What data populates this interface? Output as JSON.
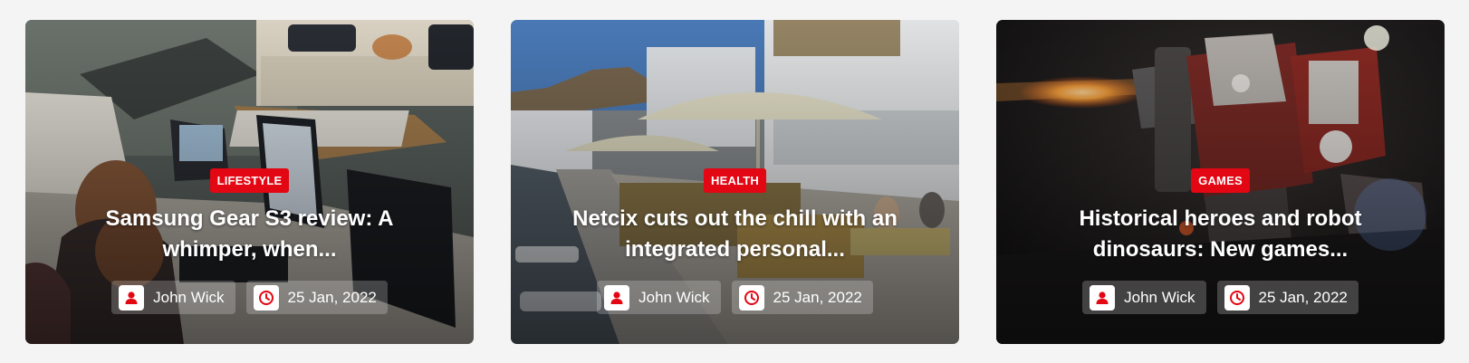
{
  "cards": [
    {
      "category": "LIFESTYLE",
      "title": "Samsung Gear S3 review: A whimper, when...",
      "author": "John Wick",
      "date": "25 Jan, 2022",
      "image": "office-desk-photo"
    },
    {
      "category": "HEALTH",
      "title": "Netcix cuts out the chill with an integrated personal...",
      "author": "John Wick",
      "date": "25 Jan, 2022",
      "image": "seaside-cafe-photo"
    },
    {
      "category": "GAMES",
      "title": "Historical heroes and robot dinosaurs: New games...",
      "author": "John Wick",
      "date": "25 Jan, 2022",
      "image": "battle-robot-photo"
    }
  ],
  "colors": {
    "accent": "#e30613",
    "page_bg": "#f4f4f5"
  },
  "icons": {
    "author": "user-icon",
    "date": "clock-icon"
  }
}
